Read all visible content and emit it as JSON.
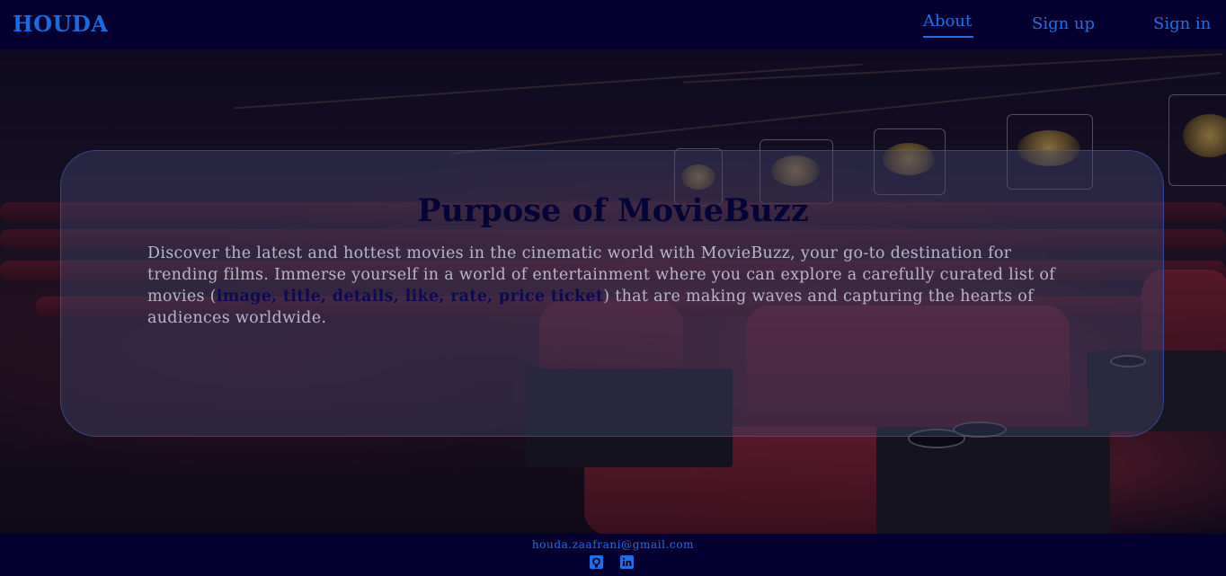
{
  "header": {
    "logo": "HOUDA",
    "nav": {
      "about": "About",
      "signup": "Sign up",
      "signin": "Sign in"
    }
  },
  "main": {
    "title": "Purpose of MovieBuzz",
    "text_before": "Discover the latest and hottest movies in the cinematic world with MovieBuzz, your go-to destination for trending films. Immerse yourself in a world of entertainment where you can explore a carefully curated list of movies (",
    "highlight": "image, title, details, like, rate, price ticket",
    "text_after": ") that are making waves and capturing the hearts of audiences worldwide."
  },
  "footer": {
    "email": "houda.zaafrani@gmail.com",
    "icons": [
      "github-icon",
      "linkedin-icon"
    ]
  },
  "colors": {
    "accent": "#1f6fe6",
    "navbar": "#03002f",
    "title": "#050437"
  }
}
